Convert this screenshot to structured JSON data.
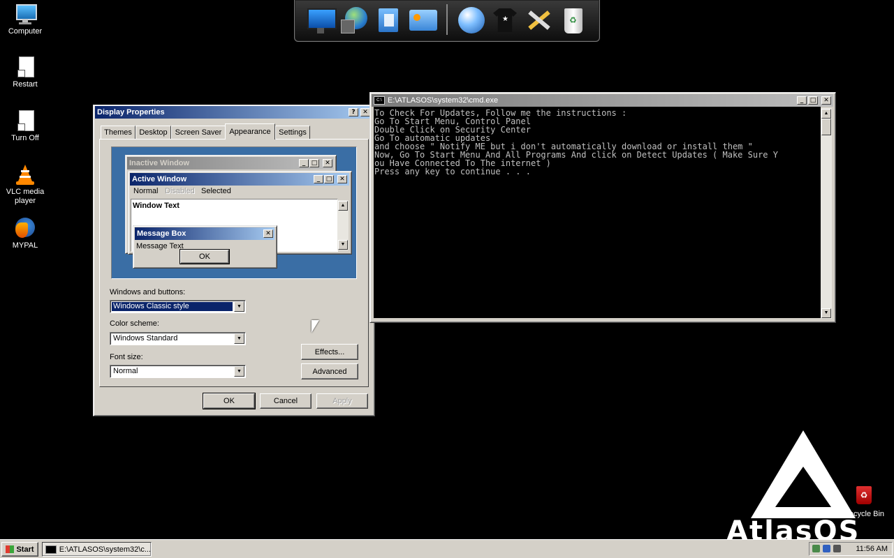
{
  "desktop": {
    "icons": [
      {
        "label": "Computer"
      },
      {
        "label": "Restart"
      },
      {
        "label": "Turn Off"
      },
      {
        "label": "VLC media player"
      },
      {
        "label": "MYPAL"
      }
    ],
    "recycle_bin_label": "Recycle Bin",
    "logo_text": "AtlasOS"
  },
  "display_properties": {
    "title": "Display Properties",
    "help_btn": "?",
    "close_btn": "✕",
    "tabs": [
      "Themes",
      "Desktop",
      "Screen Saver",
      "Appearance",
      "Settings"
    ],
    "selected_tab": "Appearance",
    "preview": {
      "inactive_title": "Inactive Window",
      "active_title": "Active Window",
      "menu": [
        "Normal",
        "Disabled",
        "Selected"
      ],
      "window_text": "Window Text",
      "msgbox_title": "Message Box",
      "msgbox_text": "Message Text",
      "msgbox_ok": "OK"
    },
    "windows_buttons_label": "Windows and buttons:",
    "windows_buttons_value": "Windows Classic style",
    "color_scheme_label": "Color scheme:",
    "color_scheme_value": "Windows Standard",
    "font_size_label": "Font size:",
    "font_size_value": "Normal",
    "effects_btn": "Effects...",
    "advanced_btn": "Advanced",
    "ok_btn": "OK",
    "cancel_btn": "Cancel",
    "apply_btn": "Apply"
  },
  "cmd": {
    "title": "E:\\ATLASOS\\system32\\cmd.exe",
    "lines": [
      "To Check For Updates, Follow me the instructions :",
      "Go To Start Menu, Control Panel",
      "Double Click on Security Center",
      "Go To automatic updates",
      "and choose \" Notify ME but i don't automatically download or install them \"",
      "Now, Go To Start Menu And All Programs And click on Detect Updates ( Make Sure Y",
      "ou Have Connected To The internet )",
      "Press any key to continue . . ."
    ]
  },
  "taskbar": {
    "start_label": "Start",
    "task_label": "E:\\ATLASOS\\system32\\c...",
    "clock": "11:56 AM"
  },
  "colors": {
    "desktop_bg": "#000000",
    "active_title_start": "#0a246a",
    "active_title_end": "#a6caf0",
    "preview_bg": "#3a6ea5",
    "face": "#d4d0c8"
  }
}
